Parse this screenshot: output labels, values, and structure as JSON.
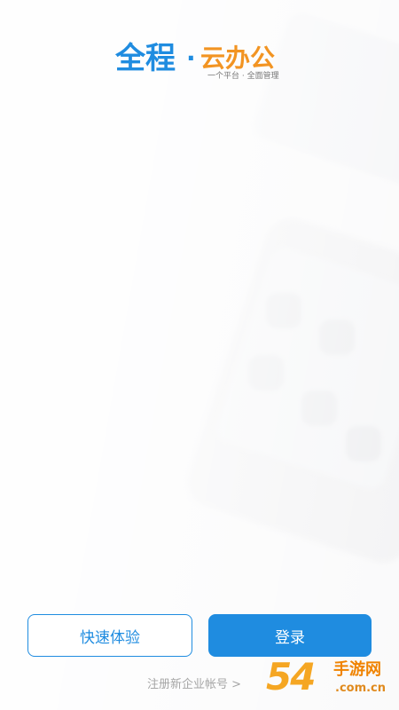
{
  "logo": {
    "main": "全程",
    "dot": "·",
    "sub": "云办公",
    "tagline": "一个平台 · 全面管理"
  },
  "buttons": {
    "quick_label": "快速体验",
    "login_label": "登录"
  },
  "register": {
    "label": "注册新企业帐号 >"
  },
  "watermark": {
    "main": "54",
    "site": "手游网",
    "domain": ".com.cn"
  },
  "colors": {
    "accent": "#1f8ce0",
    "logo_orange": "#f29422",
    "link_gray": "#a5a5a5"
  }
}
